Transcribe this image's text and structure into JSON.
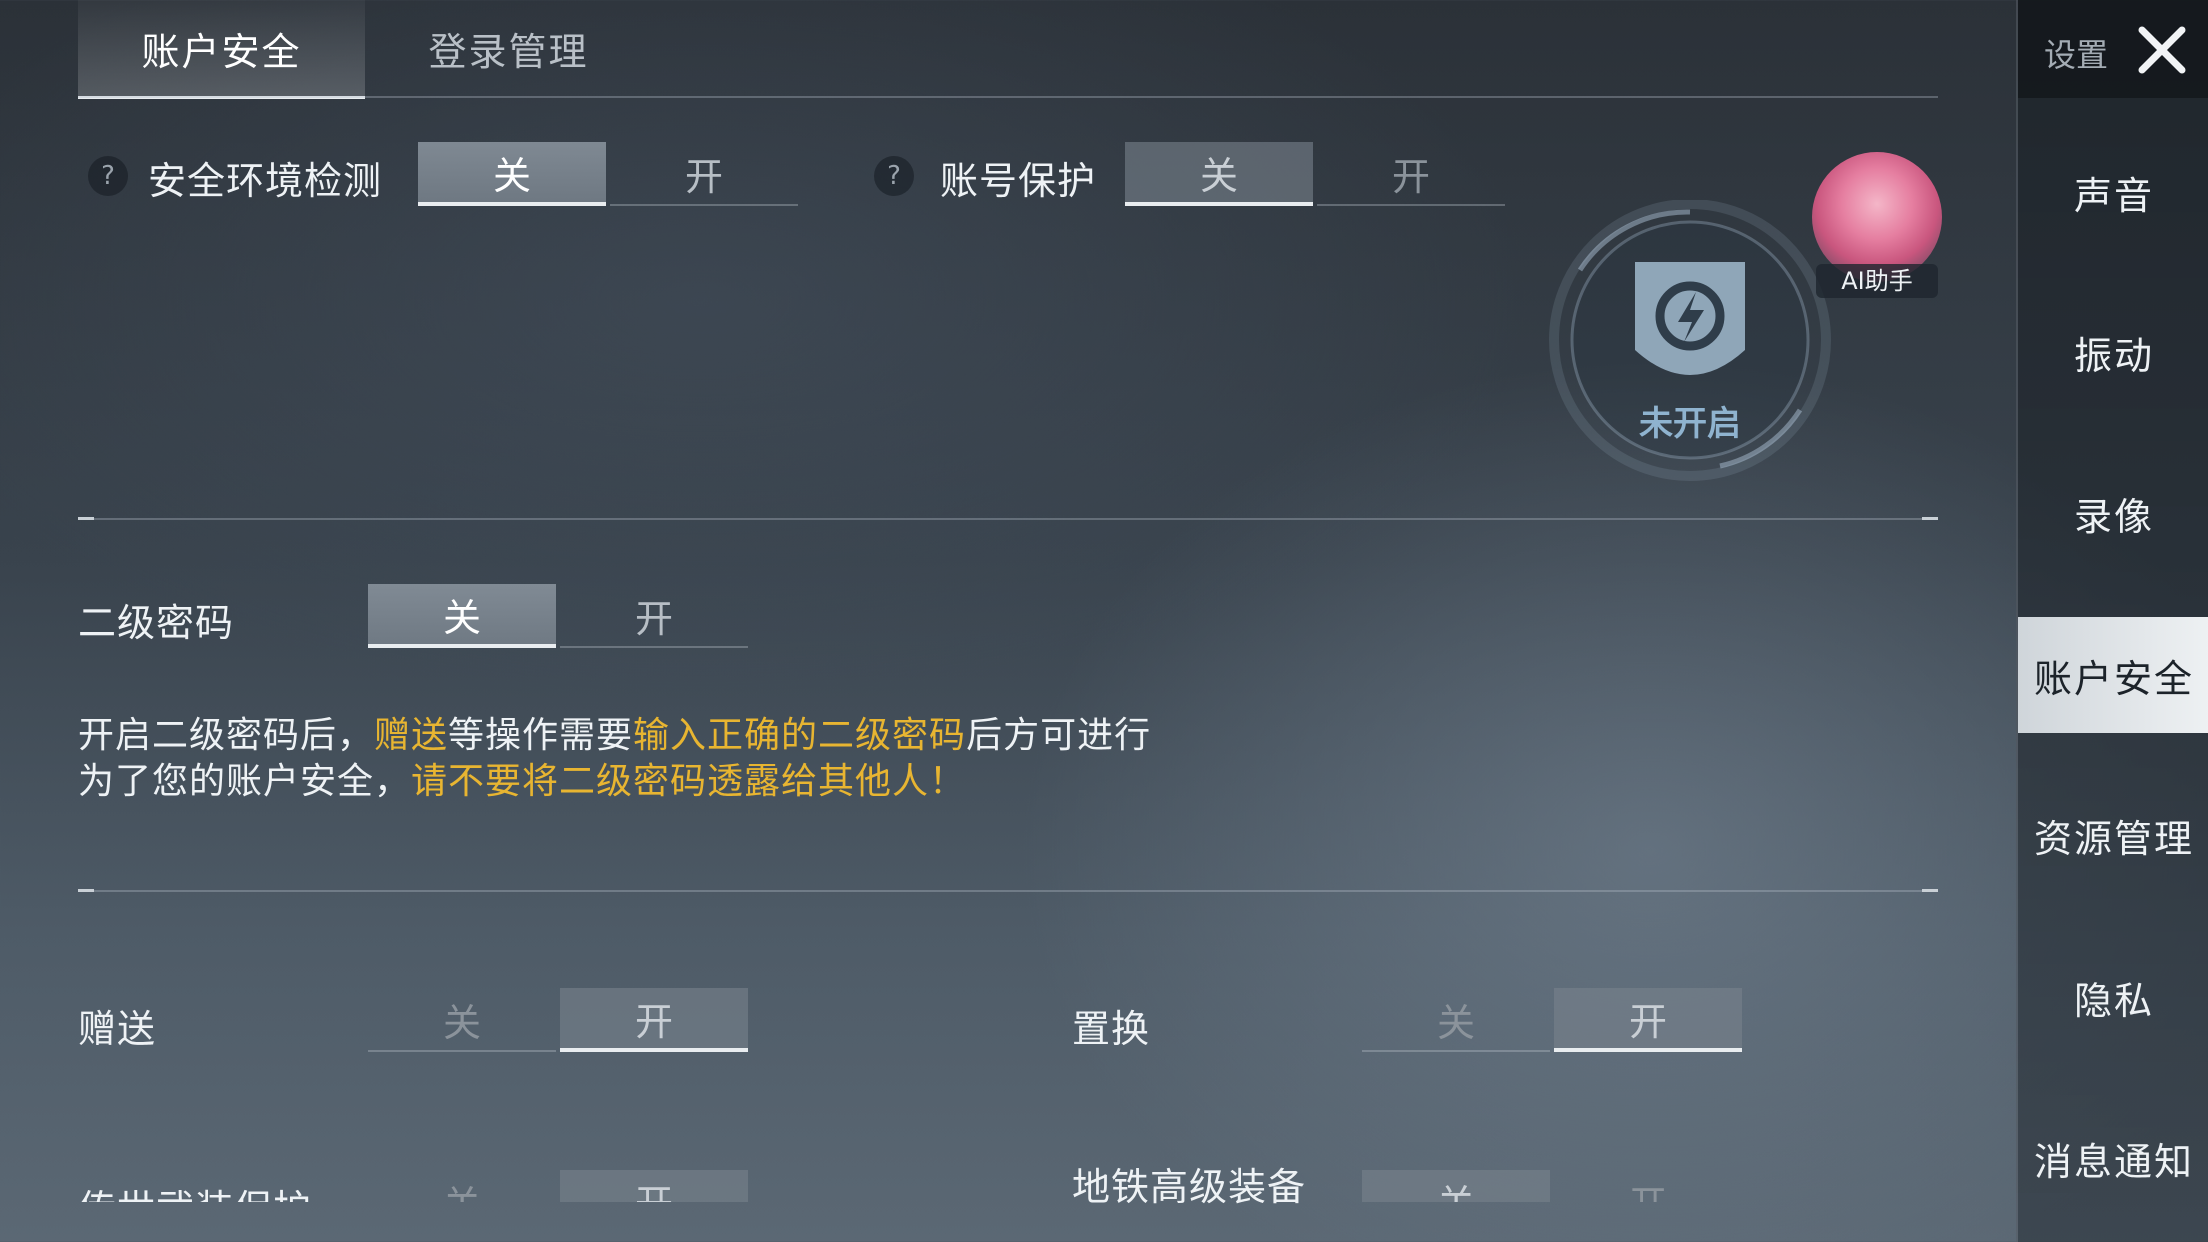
{
  "top_tabs": [
    "账户安全",
    "登录管理"
  ],
  "security_env": {
    "label": "安全环境检测",
    "help": "?",
    "off": "关",
    "on": "开",
    "state": "off"
  },
  "account_protect": {
    "label": "账号保护",
    "help": "?",
    "off": "关",
    "on": "开",
    "state": "off"
  },
  "shield_status": "未开启",
  "ai_assistant": "AI助手",
  "second_password": {
    "label": "二级密码",
    "off": "关",
    "on": "开",
    "state": "off"
  },
  "info": {
    "line1": {
      "a": "开启二级密码后，",
      "b": "赠送",
      "c": "等操作需要",
      "d": "输入正确的二级密码",
      "e": "后方可进行"
    },
    "line2": {
      "a": "为了您的账户安全，",
      "b": "请不要将二级密码透露给其他人！"
    }
  },
  "gift": {
    "label": "赠送",
    "off": "关",
    "on": "开",
    "state": "on"
  },
  "exchange": {
    "label": "置换",
    "off": "关",
    "on": "开",
    "state": "on"
  },
  "legendary_protect": {
    "label": "传世武装保护",
    "off": "关",
    "on": "开",
    "state": "on"
  },
  "metro_gear": {
    "label": "地铁高级装备",
    "off": "关",
    "on": "开",
    "state": "off"
  },
  "sidebar": {
    "title": "设置",
    "close_icon": "close-icon",
    "items": [
      "声音",
      "振动",
      "录像",
      "账户安全",
      "资源管理",
      "隐私",
      "消息通知"
    ],
    "active": "账户安全"
  },
  "colors": {
    "highlight": "#e8b531",
    "shield": "#8fa6b8"
  }
}
